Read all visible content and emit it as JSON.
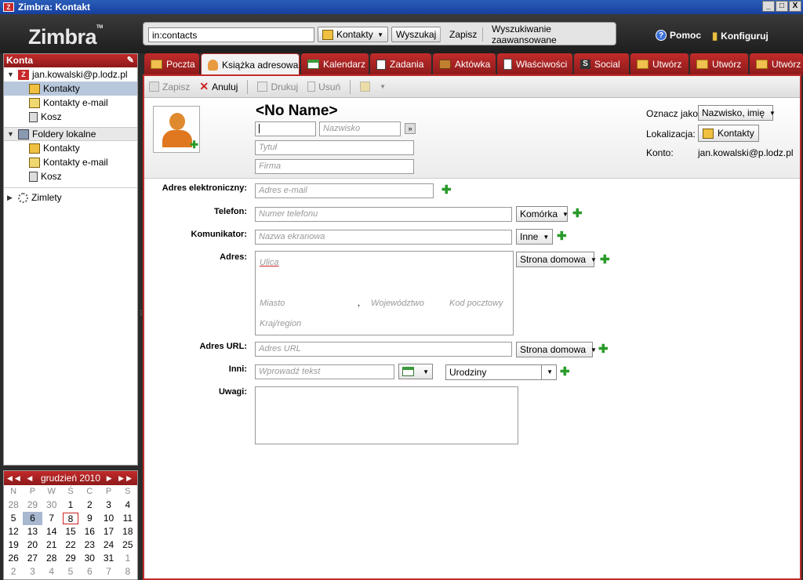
{
  "window": {
    "title": "Zimbra: Kontakt",
    "controls": [
      "_",
      "□",
      "X"
    ]
  },
  "header": {
    "logo": "Zimbra",
    "logo_tm": "TM",
    "search_value": "in:contacts",
    "search_scope": "Kontakty",
    "search_button": "Wyszukaj",
    "save_button": "Zapisz",
    "advanced_search": "Wyszukiwanie zaawansowane",
    "help": "Pomoc",
    "configure": "Konfiguruj"
  },
  "tabs": [
    "Poczta",
    "Książka adresowa",
    "Kalendarz",
    "Zadania",
    "Aktówka",
    "Właściwości",
    "Social",
    "Utwórz",
    "Utwórz",
    "Utwórz"
  ],
  "sidebar": {
    "header": "Konta",
    "account": "jan.kowalski@p.lodz.pl",
    "account_items": [
      "Kontakty",
      "Kontakty e-mail",
      "Kosz"
    ],
    "local_header": "Foldery lokalne",
    "local_items": [
      "Kontakty",
      "Kontakty e-mail",
      "Kosz"
    ],
    "zimlets": "Zimlety"
  },
  "calendar": {
    "month": "grudzień 2010",
    "dow": [
      "N",
      "P",
      "W",
      "Ś",
      "C",
      "P",
      "S"
    ],
    "weeks": [
      [
        "28",
        "29",
        "30",
        "1",
        "2",
        "3",
        "4"
      ],
      [
        "5",
        "6",
        "7",
        "8",
        "9",
        "10",
        "11"
      ],
      [
        "12",
        "13",
        "14",
        "15",
        "16",
        "17",
        "18"
      ],
      [
        "19",
        "20",
        "21",
        "22",
        "23",
        "24",
        "25"
      ],
      [
        "26",
        "27",
        "28",
        "29",
        "30",
        "31",
        "1"
      ],
      [
        "2",
        "3",
        "4",
        "5",
        "6",
        "7",
        "8"
      ]
    ]
  },
  "toolbar": {
    "save": "Zapisz",
    "cancel": "Anuluj",
    "print": "Drukuj",
    "delete": "Usuń"
  },
  "contact": {
    "name": "<No Name>",
    "first_name": "",
    "last_name_ph": "Nazwisko",
    "title_ph": "Tytuł",
    "company_ph": "Firma",
    "mark_as_label": "Oznacz jako:",
    "mark_as_value": "Nazwisko, imię",
    "location_label": "Lokalizacja:",
    "location_value": "Kontakty",
    "account_label": "Konto:",
    "account_value": "jan.kowalski@p.lodz.pl"
  },
  "form": {
    "email_label": "Adres elektroniczny:",
    "email_ph": "Adres e-mail",
    "phone_label": "Telefon:",
    "phone_ph": "Numer telefonu",
    "phone_type": "Komórka",
    "im_label": "Komunikator:",
    "im_ph": "Nazwa ekranowa",
    "im_type": "Inne",
    "address_label": "Adres:",
    "street_ph": "Ulica",
    "city_ph": "Miasto",
    "comma": ",",
    "state_ph": "Województwo",
    "zip_ph": "Kod pocztowy",
    "country_ph": "Kraj/region",
    "address_type": "Strona domowa",
    "url_label": "Adres URL:",
    "url_ph": "Adres URL",
    "url_type": "Strona domowa",
    "other_label": "Inni:",
    "other_ph": "Wprowadź tekst",
    "other_type": "Urodziny",
    "notes_label": "Uwagi:"
  }
}
